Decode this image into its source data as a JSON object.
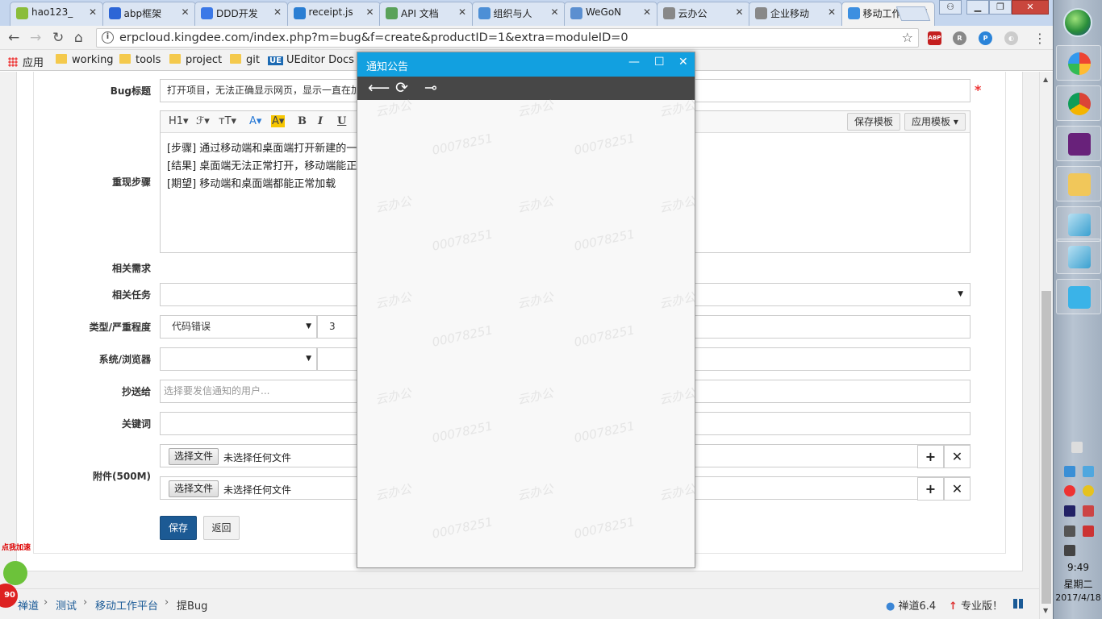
{
  "browser": {
    "tabs": [
      {
        "title": "hao123_",
        "icon": "hao123-icon",
        "color": "#8bbd3a"
      },
      {
        "title": "abp框架",
        "icon": "baidu-paw-icon",
        "color": "#2d66d6"
      },
      {
        "title": "DDD开发",
        "icon": "chrome-page-icon",
        "color": "#3b78e7"
      },
      {
        "title": "receipt.js",
        "icon": "vscode-icon",
        "color": "#2a7ed3"
      },
      {
        "title": "API 文档",
        "icon": "api-doc-icon",
        "color": "#5aa25a"
      },
      {
        "title": "组织与人",
        "icon": "globe-icon",
        "color": "#4d8fd6"
      },
      {
        "title": "WeGoN",
        "icon": "abp-icon",
        "color": "#5b8fd0"
      },
      {
        "title": "云办公",
        "icon": "page-icon",
        "color": "#888888"
      },
      {
        "title": "企业移动",
        "icon": "page-icon",
        "color": "#888888"
      },
      {
        "title": "移动工作",
        "icon": "globe-icon",
        "color": "#3d8fe0"
      }
    ],
    "url": "erpcloud.kingdee.com/index.php?m=bug&f=create&productID=1&extra=moduleID=0",
    "bookmarks": {
      "apps": "应用",
      "items": [
        "working",
        "tools",
        "project",
        "git"
      ],
      "ueditor_badge": "UE",
      "ueditor": "UEditor Docs"
    },
    "extensions": {
      "abp": "ABP"
    }
  },
  "form": {
    "title_label": "Bug标题",
    "title_value": "打开项目，无法正确显示网页，显示一直在加载",
    "required_mark": "*",
    "steps_label": "重现步骤",
    "editor_toolbar": {
      "heading": "H1▾",
      "font": "ℱ▾",
      "size": "тT▾",
      "font_color": "A▾",
      "bg_color": "A▾",
      "bold": "B",
      "italic": "I",
      "underline": "U",
      "align": "≣",
      "save_template": "保存模板",
      "apply_template": "应用模板 ▾"
    },
    "steps_lines": [
      "[步骤] 通过移动端和桌面端打开新建的一个",
      "[结果] 桌面端无法正常打开，移动端能正确",
      "[期望] 移动端和桌面端都能正常加载"
    ],
    "related_req_label": "相关需求",
    "related_task_label": "相关任务",
    "type_label": "类型/严重程度",
    "type_value": "代码错误",
    "severity_value": "3",
    "os_label": "系统/浏览器",
    "mailto_label": "抄送给",
    "mailto_placeholder": "选择要发信通知的用户...",
    "keywords_label": "关键词",
    "attach_label": "附件(500M)",
    "file_button": "选择文件",
    "file_none": "未选择任何文件",
    "save": "保存",
    "back": "返回"
  },
  "breadcrumb": {
    "items": [
      "禅道",
      "测试",
      "移动工作平台"
    ],
    "current": "提Bug",
    "version": "禅道6.4",
    "pro": "专业版！"
  },
  "accelerator": {
    "label": "点我加速",
    "value": "90"
  },
  "popup": {
    "title": "通知公告",
    "watermark_text": "云办公",
    "watermark_id": "00078251"
  },
  "taskbar": {
    "time": "9:49",
    "day": "星期二",
    "date": "2017/4/18"
  }
}
